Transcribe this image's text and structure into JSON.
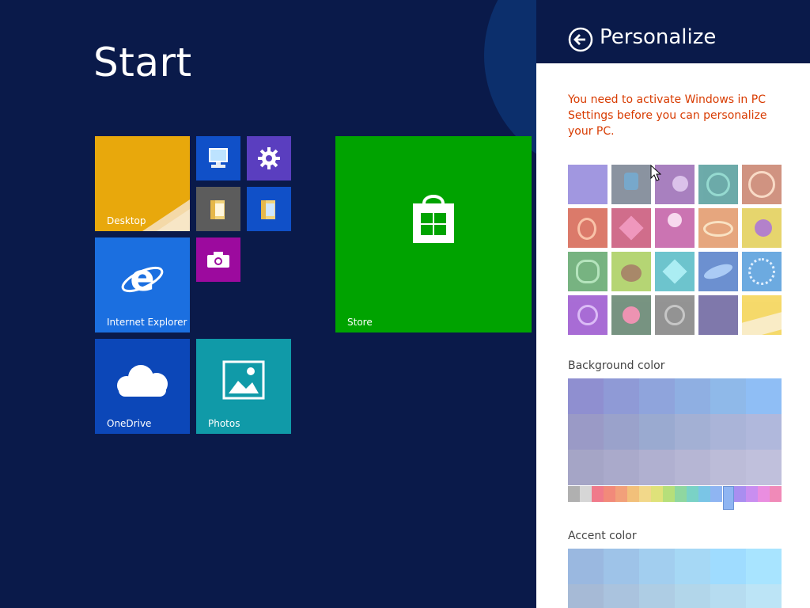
{
  "start": {
    "title": "Start",
    "tiles": {
      "desktop": "Desktop",
      "internet_explorer": "Internet Explorer",
      "onedrive": "OneDrive",
      "photos": "Photos",
      "store": "Store"
    }
  },
  "pane": {
    "title": "Personalize",
    "warning": "You need to activate Windows in PC Settings before you can personalize your PC.",
    "background_label": "Background color",
    "accent_label": "Accent color"
  },
  "colors": {
    "start_bg": "#0a1a4a",
    "desktop_tile": "#e8a80c",
    "ie_tile": "#1b6fe0",
    "onedrive_tile": "#0c47b8",
    "photos_tile": "#109aa8",
    "store_tile": "#00a300",
    "settings_tile": "#5a3ebf",
    "camera_tile": "#9c0a9e",
    "warning_text": "#d83b01"
  },
  "icons": [
    "back-arrow-icon",
    "gear-icon",
    "computer-icon",
    "folder-icon",
    "camera-icon",
    "internet-explorer-icon",
    "cloud-icon",
    "photo-icon",
    "store-bag-icon",
    "cursor-icon"
  ]
}
